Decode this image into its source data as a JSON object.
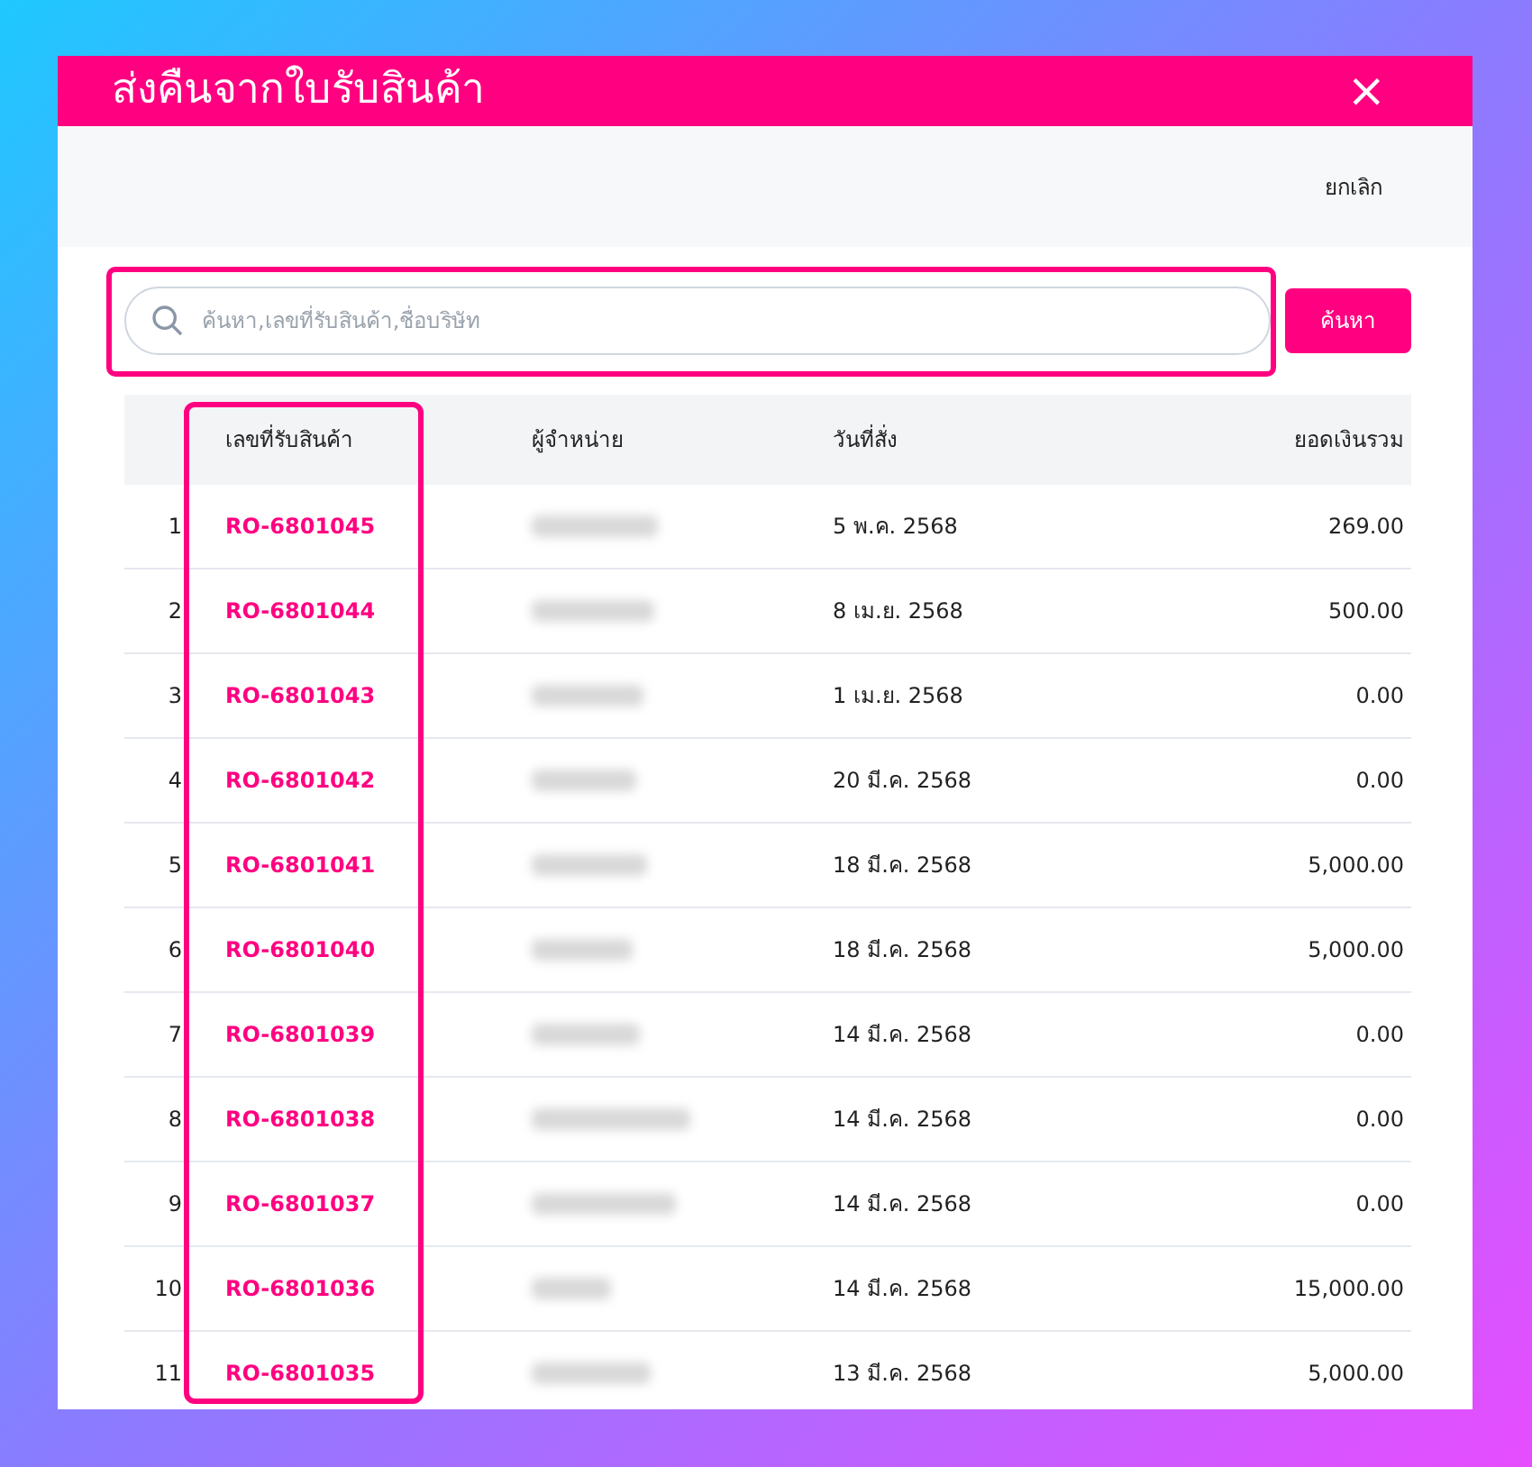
{
  "dialog": {
    "title": "ส่งคืนจากใบรับสินค้า",
    "close": "×",
    "cancel": "ยกเลิก"
  },
  "search": {
    "placeholder": "ค้นหา,เลขที่รับสินค้า,ชื่อบริษัท",
    "button": "ค้นหา"
  },
  "table": {
    "columns": [
      "เลขที่รับสินค้า",
      "ผู้จำหน่าย",
      "วันที่สั่ง",
      "ยอดเงินรวม"
    ],
    "rows": [
      {
        "no": "1",
        "code": "RO-6801045",
        "date": "5 พ.ค. 2568",
        "total": "269.00"
      },
      {
        "no": "2",
        "code": "RO-6801044",
        "date": "8 เม.ย. 2568",
        "total": "500.00"
      },
      {
        "no": "3",
        "code": "RO-6801043",
        "date": "1 เม.ย. 2568",
        "total": "0.00"
      },
      {
        "no": "4",
        "code": "RO-6801042",
        "date": "20 มี.ค. 2568",
        "total": "0.00"
      },
      {
        "no": "5",
        "code": "RO-6801041",
        "date": "18 มี.ค. 2568",
        "total": "5,000.00"
      },
      {
        "no": "6",
        "code": "RO-6801040",
        "date": "18 มี.ค. 2568",
        "total": "5,000.00"
      },
      {
        "no": "7",
        "code": "RO-6801039",
        "date": "14 มี.ค. 2568",
        "total": "0.00"
      },
      {
        "no": "8",
        "code": "RO-6801038",
        "date": "14 มี.ค. 2568",
        "total": "0.00"
      },
      {
        "no": "9",
        "code": "RO-6801037",
        "date": "14 มี.ค. 2568",
        "total": "0.00"
      },
      {
        "no": "10",
        "code": "RO-6801036",
        "date": "14 มี.ค. 2568",
        "total": "15,000.00"
      },
      {
        "no": "11",
        "code": "RO-6801035",
        "date": "13 มี.ค. 2568",
        "total": "5,000.00"
      }
    ]
  }
}
